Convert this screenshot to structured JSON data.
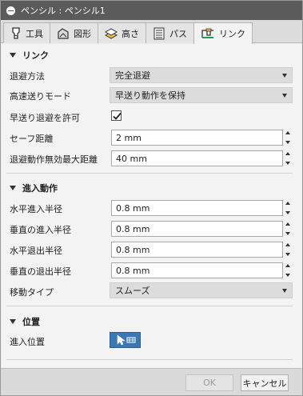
{
  "window": {
    "title": "ペンシル : ペンシル1"
  },
  "tabs": [
    {
      "label": "工具",
      "icon": "tool-icon"
    },
    {
      "label": "図形",
      "icon": "geometry-icon"
    },
    {
      "label": "高さ",
      "icon": "heights-icon"
    },
    {
      "label": "パス",
      "icon": "passes-icon"
    },
    {
      "label": "リンク",
      "icon": "linking-icon",
      "active": true
    }
  ],
  "link_section": {
    "title": "リンク",
    "retract_policy_label": "退避方法",
    "retract_policy_value": "完全退避",
    "high_feed_label": "高速送りモード",
    "high_feed_value": "早送り動作を保持",
    "allow_rapid_label": "早送り退避を許可",
    "allow_rapid_checked": true,
    "safe_distance_label": "セーフ距離",
    "safe_distance_value": "2 mm",
    "max_stay_down_label": "退避動作無効最大距離",
    "max_stay_down_value": "40 mm"
  },
  "leadin_section": {
    "title": "進入動作",
    "h_lead_in_label": "水平進入半径",
    "h_lead_in_value": "0.8 mm",
    "v_lead_in_label": "垂直の進入半径",
    "v_lead_in_value": "0.8 mm",
    "h_lead_out_label": "水平退出半径",
    "h_lead_out_value": "0.8 mm",
    "v_lead_out_label": "垂直の退出半径",
    "v_lead_out_value": "0.8 mm",
    "transition_label": "移動タイプ",
    "transition_value": "スムーズ"
  },
  "position_section": {
    "title": "位置",
    "entry_label": "進入位置",
    "entry_icon": "cursor-select-icon"
  },
  "footer": {
    "ok_label": "OK",
    "cancel_label": "キャンセル"
  },
  "colors": {
    "titlebar": "#5b5b5b",
    "accent_button": "#3a78b5"
  }
}
